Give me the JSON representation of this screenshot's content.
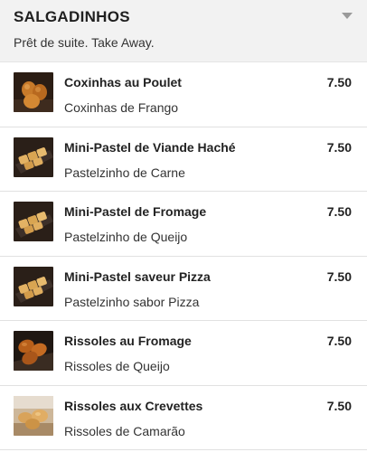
{
  "section": {
    "title": "SALGADINHOS",
    "subtitle": "Prêt de suite. Take Away.",
    "chevron_icon": "chevron-down-icon"
  },
  "items": [
    {
      "name": "Coxinhas au Poulet",
      "description": "Coxinhas de Frango",
      "price": "7.50",
      "image": "coxinhas-photo"
    },
    {
      "name": "Mini-Pastel de Viande Haché",
      "description": "Pastelzinho de Carne",
      "price": "7.50",
      "image": "pastel-photo"
    },
    {
      "name": "Mini-Pastel de Fromage",
      "description": "Pastelzinho de Queijo",
      "price": "7.50",
      "image": "pastel-photo"
    },
    {
      "name": "Mini-Pastel saveur Pizza",
      "description": "Pastelzinho sabor Pizza",
      "price": "7.50",
      "image": "pastel-photo"
    },
    {
      "name": "Rissoles au Fromage",
      "description": "Rissoles de Queijo",
      "price": "7.50",
      "image": "rissoles-photo"
    },
    {
      "name": "Rissoles aux Crevettes",
      "description": "Rissoles de Camarão",
      "price": "7.50",
      "image": "rissoles-light-photo"
    }
  ],
  "colors": {
    "header_bg": "#f2f2f2",
    "divider": "#e1e1e1",
    "text": "#222222"
  }
}
